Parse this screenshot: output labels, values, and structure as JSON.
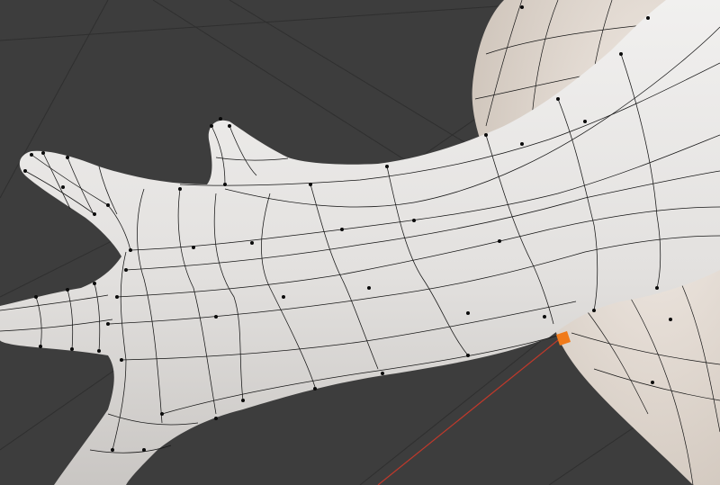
{
  "viewport": {
    "colors": {
      "background": "#3d3d3d",
      "grid_line": "#2f2f2f",
      "x_axis": "#c0392b",
      "origin_marker": "#f07a1a",
      "hand_surface": "#e6e4e2",
      "sphere_surface": "#e8dfd7",
      "wire": "#151515",
      "vertex": "#0a0a0a"
    },
    "icons": [
      "origin-icon"
    ]
  }
}
